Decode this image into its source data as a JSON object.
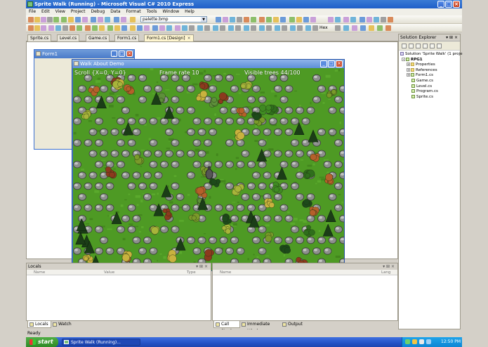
{
  "window": {
    "title": "Sprite Walk (Running) - Microsoft Visual C# 2010 Express",
    "controls": {
      "minimize": "_",
      "maximize": "□",
      "close": "×"
    }
  },
  "menu": [
    "File",
    "Edit",
    "View",
    "Project",
    "Debug",
    "Data",
    "Format",
    "Tools",
    "Window",
    "Help"
  ],
  "toolbar": {
    "file_combo_value": "palette.bmp",
    "hex_label": "Hex"
  },
  "doc_tabs": [
    {
      "label": "Sprite.cs",
      "active": false
    },
    {
      "label": "Level.cs",
      "active": false
    },
    {
      "label": "Game.cs",
      "active": false
    },
    {
      "label": "Form1.cs",
      "active": false
    },
    {
      "label": "Form1.cs [Design]",
      "active": true
    }
  ],
  "designer_form": {
    "title": "Form1"
  },
  "walk_window": {
    "title": "Walk About Demo",
    "hud": {
      "scroll": "Scroll {X=0, Y=0}",
      "frame_rate": "Frame rate 10",
      "visible_trees": "Visible trees 44/100"
    }
  },
  "solution_explorer": {
    "title": "Solution Explorer",
    "items": [
      {
        "label": "Solution 'Sprite Walk' (1 proje",
        "level": 0,
        "icon": "solution-icon"
      },
      {
        "label": "RPG1",
        "level": 1,
        "icon": "project-icon",
        "bold": true
      },
      {
        "label": "Properties",
        "level": 2,
        "icon": "folder-icon"
      },
      {
        "label": "References",
        "level": 2,
        "icon": "folder-icon"
      },
      {
        "label": "Form1.cs",
        "level": 2,
        "icon": "form-icon"
      },
      {
        "label": "Game.cs",
        "level": 2,
        "icon": "cs-file-icon"
      },
      {
        "label": "Level.cs",
        "level": 2,
        "icon": "cs-file-icon"
      },
      {
        "label": "Program.cs",
        "level": 2,
        "icon": "cs-file-icon"
      },
      {
        "label": "Sprite.cs",
        "level": 2,
        "icon": "cs-file-icon"
      }
    ]
  },
  "locals_pane": {
    "title": "Locals",
    "columns": [
      "Name",
      "Value",
      "Type"
    ],
    "tabs": [
      "Locals",
      "Watch"
    ]
  },
  "callstack_pane": {
    "columns": [
      "Name",
      "Lang"
    ],
    "tabs": [
      "Call Stack",
      "Immediate Window",
      "Output"
    ]
  },
  "status": "Ready",
  "taskbar": {
    "start": "start",
    "task": "Sprite Walk (Running)...",
    "clock": "12:50 PM"
  },
  "colors": {
    "grass": "#4e9a24",
    "title_blue": "#1f5fc8",
    "taskbar_blue": "#2453c6",
    "start_green": "#2e8a27"
  }
}
